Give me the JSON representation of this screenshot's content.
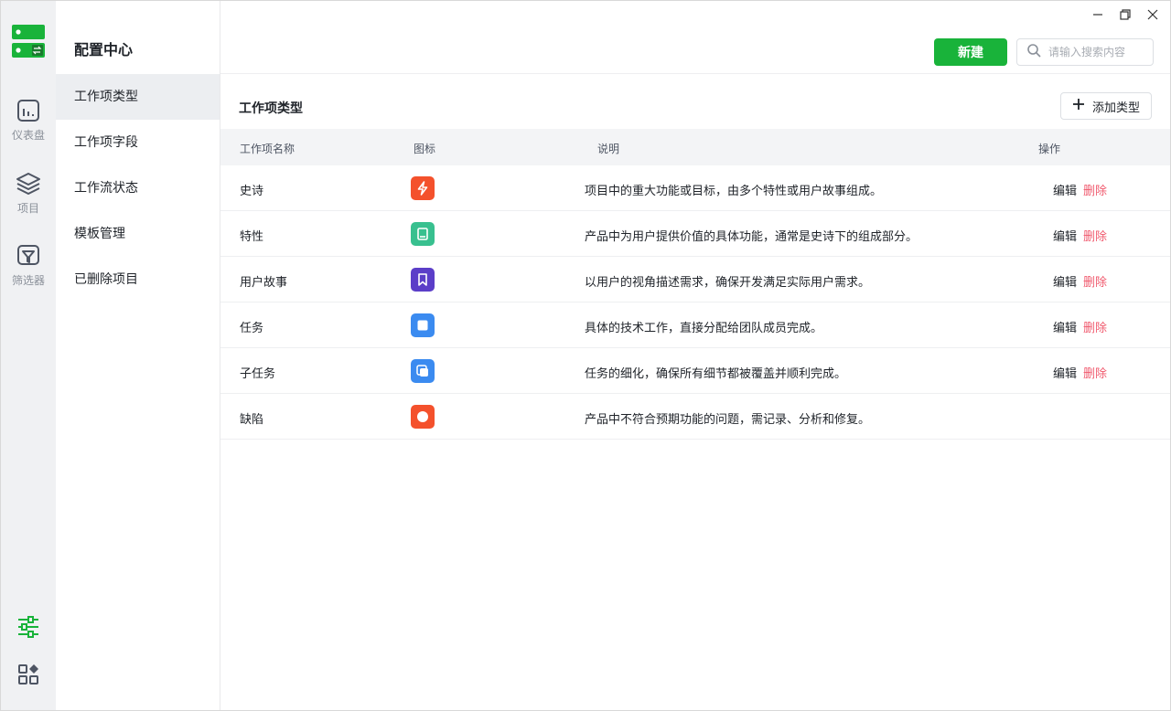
{
  "app": {
    "name": "配置中心",
    "logo_icon": "server-logo-icon"
  },
  "rail": {
    "items": [
      {
        "label": "仪表盘",
        "icon": "dashboard-icon"
      },
      {
        "label": "项目",
        "icon": "layers-icon"
      },
      {
        "label": "筛选器",
        "icon": "filter-icon"
      }
    ],
    "bottom_icons": [
      "settings-sliders-icon",
      "apps-grid-icon"
    ]
  },
  "subnav": {
    "items": [
      {
        "label": "工作项类型",
        "active": true
      },
      {
        "label": "工作项字段"
      },
      {
        "label": "工作流状态"
      },
      {
        "label": "模板管理"
      },
      {
        "label": "已删除项目"
      }
    ]
  },
  "header": {
    "new_label": "新建",
    "search_placeholder": "请输入搜索内容"
  },
  "main": {
    "title": "工作项类型",
    "add_label": "添加类型",
    "columns": [
      "工作项名称",
      "图标",
      "说明",
      "操作"
    ],
    "edit_label": "编辑",
    "delete_label": "删除",
    "rows": [
      {
        "name": "史诗",
        "icon": "lightning-icon",
        "color": "#f4512c",
        "desc": "项目中的重大功能或目标，由多个特性或用户故事组成。",
        "actions": true
      },
      {
        "name": "特性",
        "icon": "book-icon",
        "color": "#38c08f",
        "desc": "产品中为用户提供价值的具体功能，通常是史诗下的组成部分。",
        "actions": true
      },
      {
        "name": "用户故事",
        "icon": "bookmark-icon",
        "color": "#5b3ec8",
        "desc": "以用户的视角描述需求，确保开发满足实际用户需求。",
        "actions": true
      },
      {
        "name": "任务",
        "icon": "square-icon",
        "color": "#3b8bf0",
        "desc": "具体的技术工作，直接分配给团队成员完成。",
        "actions": true
      },
      {
        "name": "子任务",
        "icon": "stacked-squares-icon",
        "color": "#3b8bf0",
        "desc": "任务的细化，确保所有细节都被覆盖并顺利完成。",
        "actions": true
      },
      {
        "name": "缺陷",
        "icon": "circle-icon",
        "color": "#f4512c",
        "desc": "产品中不符合预期功能的问题，需记录、分析和修复。",
        "actions": false
      }
    ]
  },
  "colors": {
    "accent": "#19b33a",
    "danger": "#f05a6e"
  }
}
